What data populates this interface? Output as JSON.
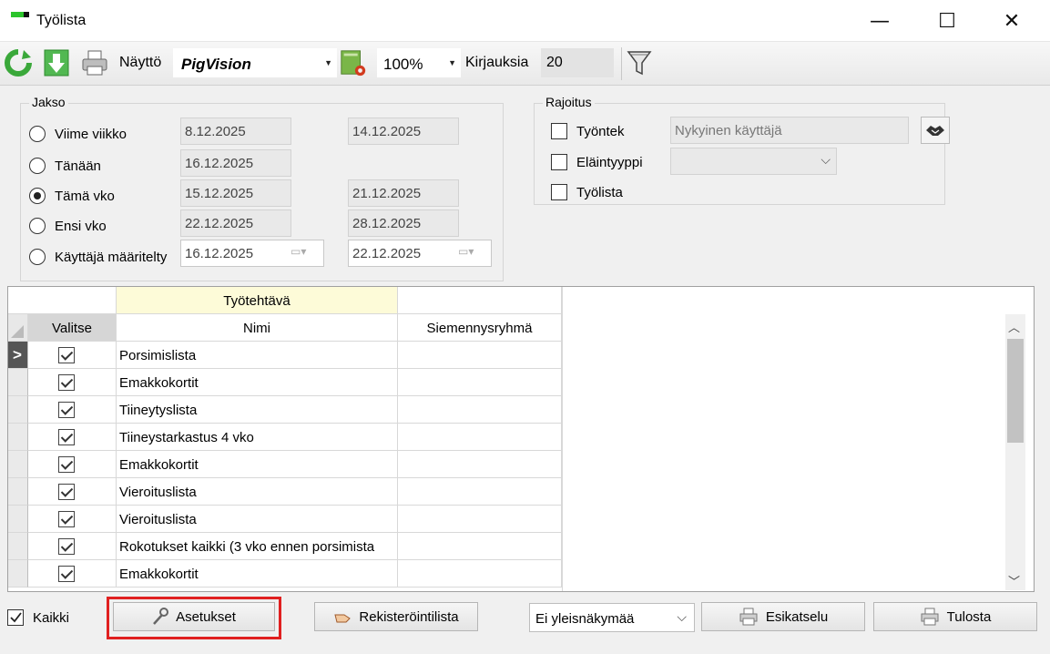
{
  "window": {
    "title": "Työlista",
    "minimize": "—",
    "maximize": "☐",
    "close": "✕"
  },
  "toolbar": {
    "naytto_label": "Näyttö",
    "naytto_value": "PigVision",
    "zoom_value": "100%",
    "kirjauksia_label": "Kirjauksia",
    "kirjauksia_value": "20"
  },
  "jakso": {
    "title": "Jakso",
    "options": [
      {
        "label": "Viime viikko",
        "from": "8.12.2025",
        "to": "14.12.2025",
        "checked": false
      },
      {
        "label": "Tänään",
        "from": "16.12.2025",
        "to": "",
        "checked": false
      },
      {
        "label": "Tämä vko",
        "from": "15.12.2025",
        "to": "21.12.2025",
        "checked": true
      },
      {
        "label": "Ensi vko",
        "from": "22.12.2025",
        "to": "28.12.2025",
        "checked": false
      },
      {
        "label": "Käyttäjä määritelty",
        "from": "16.12.2025",
        "to": "22.12.2025",
        "checked": false
      }
    ]
  },
  "rajoitus": {
    "title": "Rajoitus",
    "tyontek_label": "Työntek",
    "tyontek_value": "Nykyinen käyttäjä",
    "elaintyyppi_label": "Eläintyyppi",
    "tyolista_label": "Työlista"
  },
  "grid": {
    "group_header": "Työtehtävä",
    "col_valitse": "Valitse",
    "col_nimi": "Nimi",
    "col_siemennys": "Siemennysryhmä",
    "current_row_marker": ">",
    "rows": [
      {
        "nimi": "Porsimislista",
        "checked": true
      },
      {
        "nimi": "Emakkokortit",
        "checked": true
      },
      {
        "nimi": "Tiineytyslista",
        "checked": true
      },
      {
        "nimi": "Tiineystarkastus 4 vko",
        "checked": true
      },
      {
        "nimi": "Emakkokortit",
        "checked": true
      },
      {
        "nimi": "Vieroituslista",
        "checked": true
      },
      {
        "nimi": "Vieroituslista",
        "checked": true
      },
      {
        "nimi": "Rokotukset kaikki (3 vko ennen porsimista",
        "checked": true
      },
      {
        "nimi": "Emakkokortit",
        "checked": true
      }
    ]
  },
  "bottom": {
    "kaikki_label": "Kaikki",
    "asetukset_label": "Asetukset",
    "rekisterointilista_label": "Rekisteröintilista",
    "view_select": "Ei yleisnäkymää",
    "esikatselu_label": "Esikatselu",
    "tulosta_label": "Tulosta"
  },
  "colors": {
    "highlight": "#e02020",
    "group_header_bg": "#fdfbd8",
    "accent_green": "#2cc42c"
  }
}
